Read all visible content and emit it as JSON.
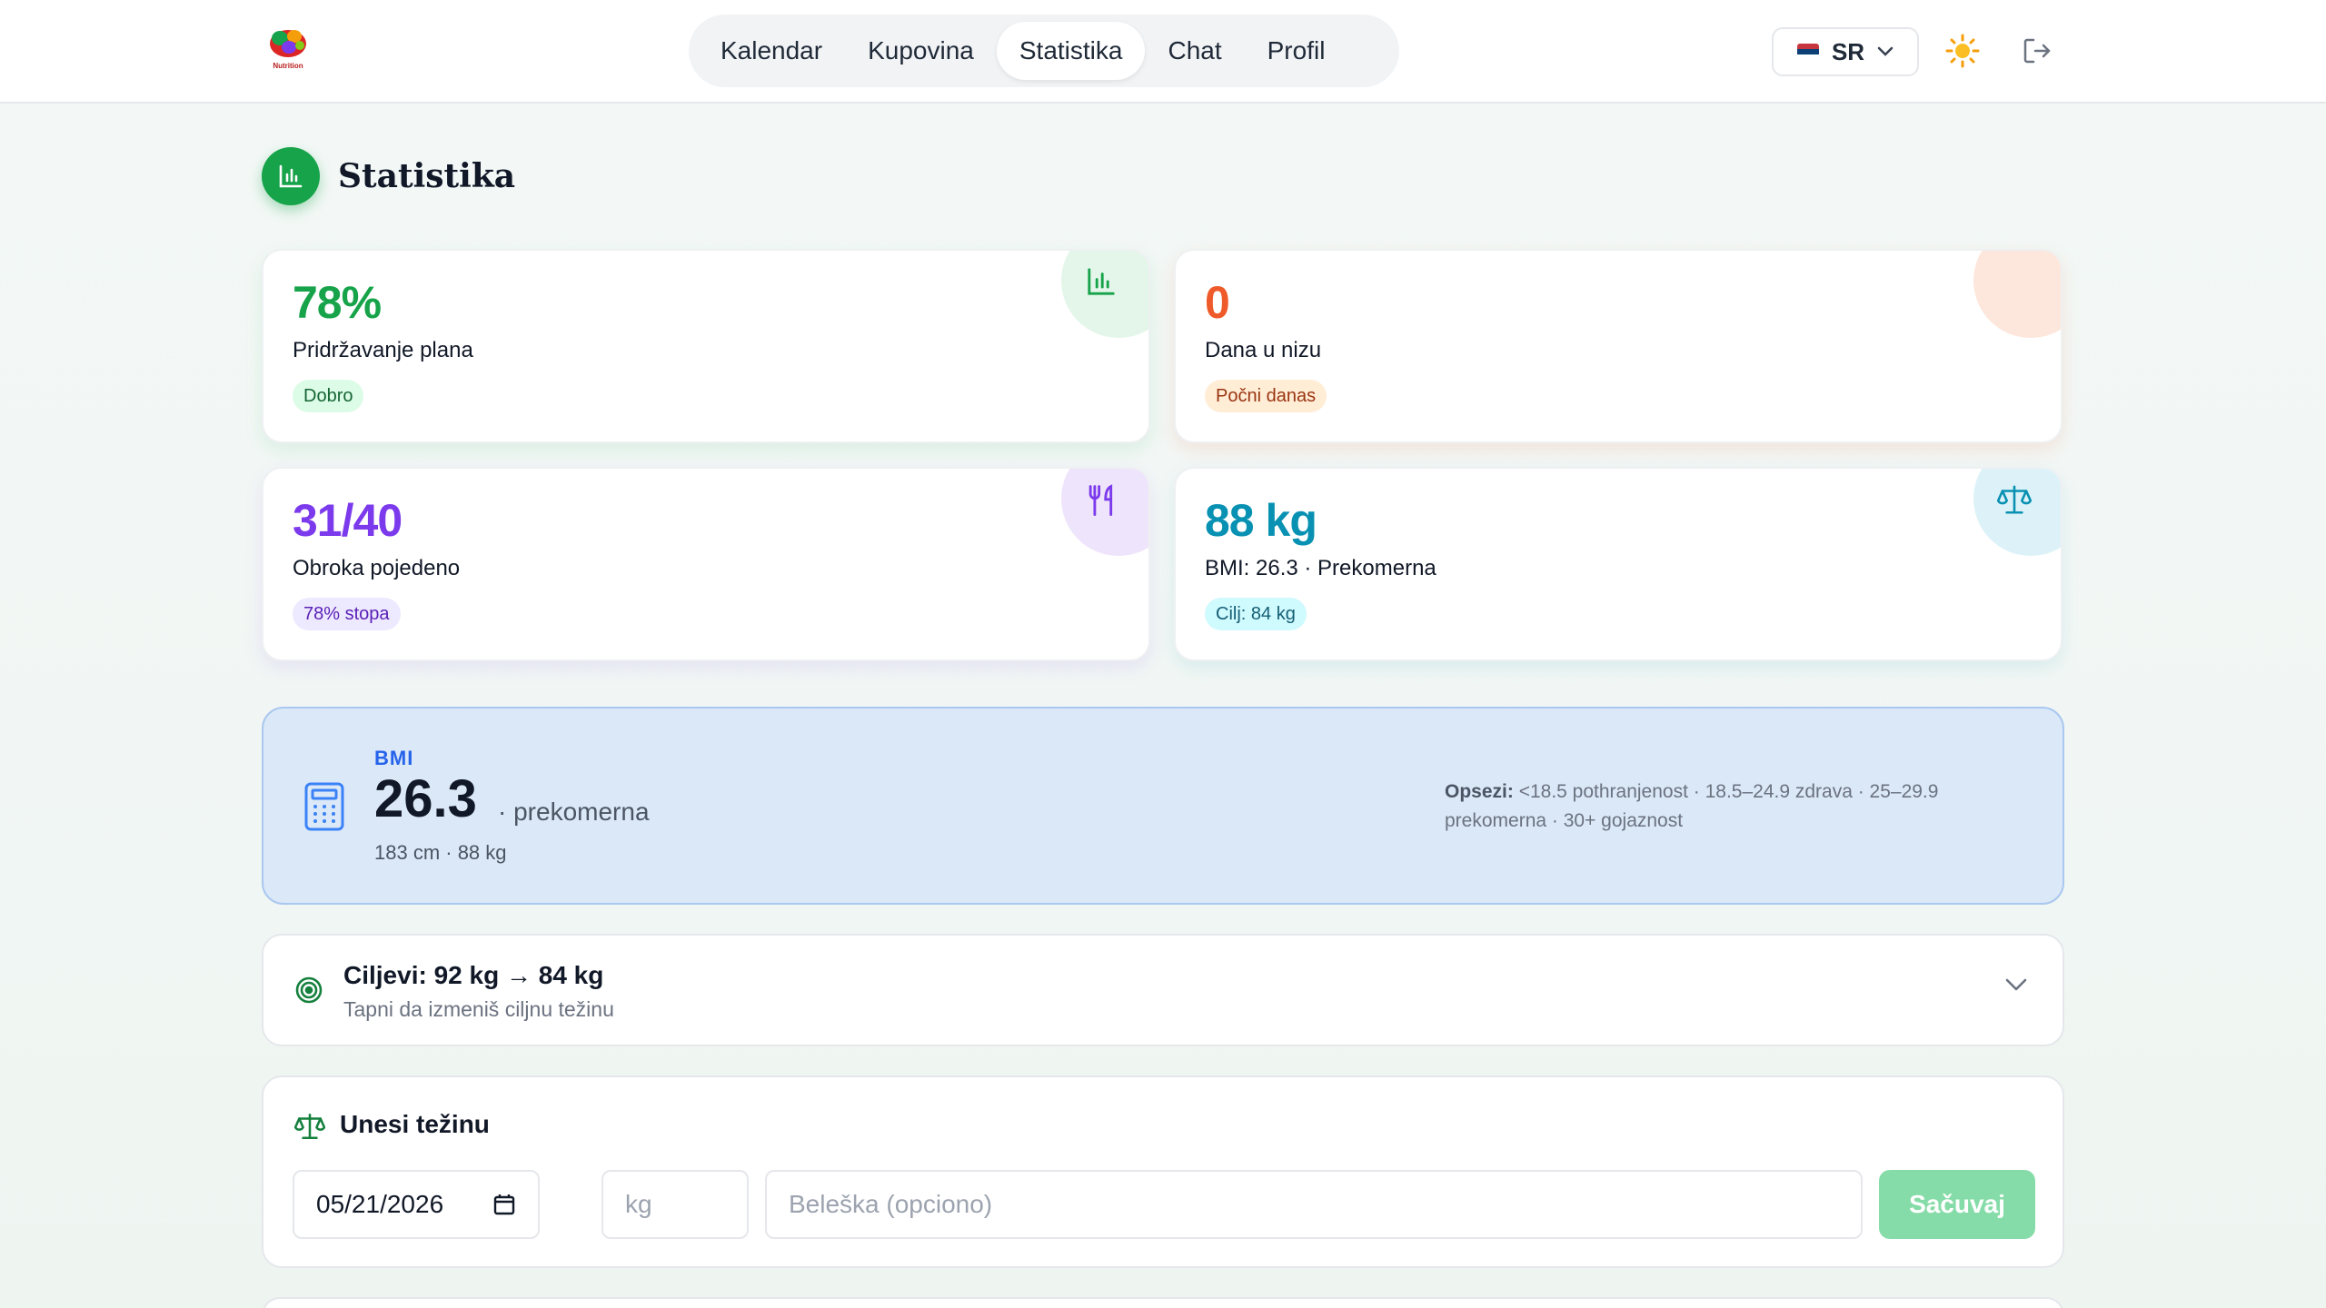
{
  "header": {
    "logo_text": "Nutrition",
    "nav": [
      {
        "label": "Kalendar"
      },
      {
        "label": "Kupovina"
      },
      {
        "label": "Statistika"
      },
      {
        "label": "Chat"
      },
      {
        "label": "Profil"
      }
    ],
    "active_tab": "Statistika",
    "language": "SR"
  },
  "page": {
    "title": "Statistika"
  },
  "cards": {
    "adherence": {
      "value": "78%",
      "label": "Pridržavanje plana",
      "badge": "Dobro",
      "color": "#16a34a",
      "icon": "bar-chart-icon"
    },
    "streak": {
      "value": "0",
      "label": "Dana u nizu",
      "badge": "Počni danas",
      "color": "#ef5a2a"
    },
    "meals": {
      "value": "31/40",
      "label": "Obroka pojedeno",
      "badge": "78% stopa",
      "color": "#7c3aed",
      "icon": "utensils-icon"
    },
    "weight": {
      "value": "88 kg",
      "label": "BMI: 26.3 · Prekomerna",
      "badge": "Cilj: 84 kg",
      "color": "#0891b2",
      "icon": "scale-icon"
    }
  },
  "bmi": {
    "caption": "BMI",
    "value": "26.3",
    "category": "· prekomerna",
    "details": "183 cm · 88 kg",
    "ranges_label": "Opsezi:",
    "ranges_text": " <18.5 pothranjenost · 18.5–24.9 zdrava · 25–29.9 prekomerna · 30+ gojaznost"
  },
  "goals": {
    "title": "Ciljevi: 92 kg → 84 kg",
    "subtitle": "Tapni da izmeniš ciljnu težinu"
  },
  "weight_entry": {
    "title": "Unesi težinu",
    "date_value": "05/21/2026",
    "kg_placeholder": "kg",
    "note_placeholder": "Beleška (opciono)",
    "save_label": "Sačuvaj"
  }
}
